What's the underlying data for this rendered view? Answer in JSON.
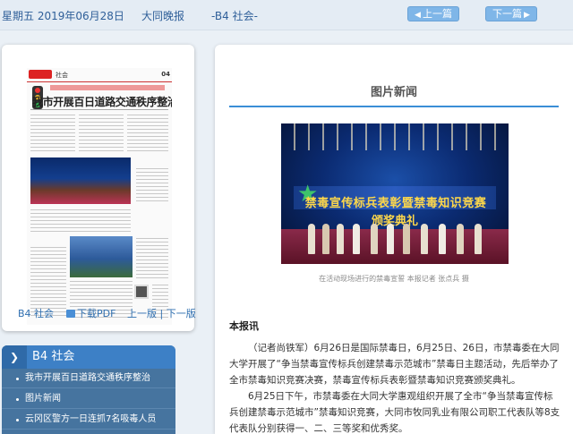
{
  "topbar": {
    "date": "星期五 2019年06月28日",
    "paper": "大同晚报",
    "page": "-B4 社会-",
    "prev_label": "上一篇",
    "next_label": "下一篇"
  },
  "thumbnail": {
    "section": "社会",
    "page_no": "04",
    "headline": "我市开展百日道路交通秩序整治",
    "footer": {
      "page_label": "B4 社会",
      "pdf_label": "下载PDF",
      "prevnext_label": "上一版 | 下一版"
    }
  },
  "sidebar": {
    "title": "B4 社会",
    "items": [
      {
        "label": "我市开展百日道路交通秩序整治"
      },
      {
        "label": "图片新闻"
      },
      {
        "label": "云冈区警方一日连抓7名吸毒人员"
      }
    ]
  },
  "article": {
    "title": "图片新闻",
    "photo_banner_line1": "禁毒宣传标兵表彰暨禁毒知识竞赛",
    "photo_banner_line2": "颁奖典礼",
    "caption": "在活动现场进行的禁毒宣誓 本报记者 张点兵 摄",
    "byline": "本报讯",
    "paragraphs": [
      "（记者尚铁军）6月26日是国际禁毒日，6月25日、26日，市禁毒委在大同大学开展了“争当禁毒宣传标兵创建禁毒示范城市”禁毒日主题活动，先后举办了全市禁毒知识竞赛决赛，禁毒宣传标兵表彰暨禁毒知识竞赛颁奖典礼。",
      "6月25日下午，市禁毒委在大同大学惠观组织开展了全市“争当禁毒宣传标兵创建禁毒示范城市”禁毒知识竞赛，大同市牧同乳业有限公司职工代表队等8支代表队分别获得一、二、三等奖和优秀奖。"
    ]
  },
  "icons": {
    "prev": "chevron-left-icon",
    "next": "chevron-right-icon",
    "pdf": "pdf-icon",
    "section": "chevron-right-icon"
  },
  "colors": {
    "accent": "#3a8ed6",
    "nav_button": "#7fb6e8",
    "sidebar_bg": "#46749f",
    "sidebar_head": "#3d80c6"
  }
}
